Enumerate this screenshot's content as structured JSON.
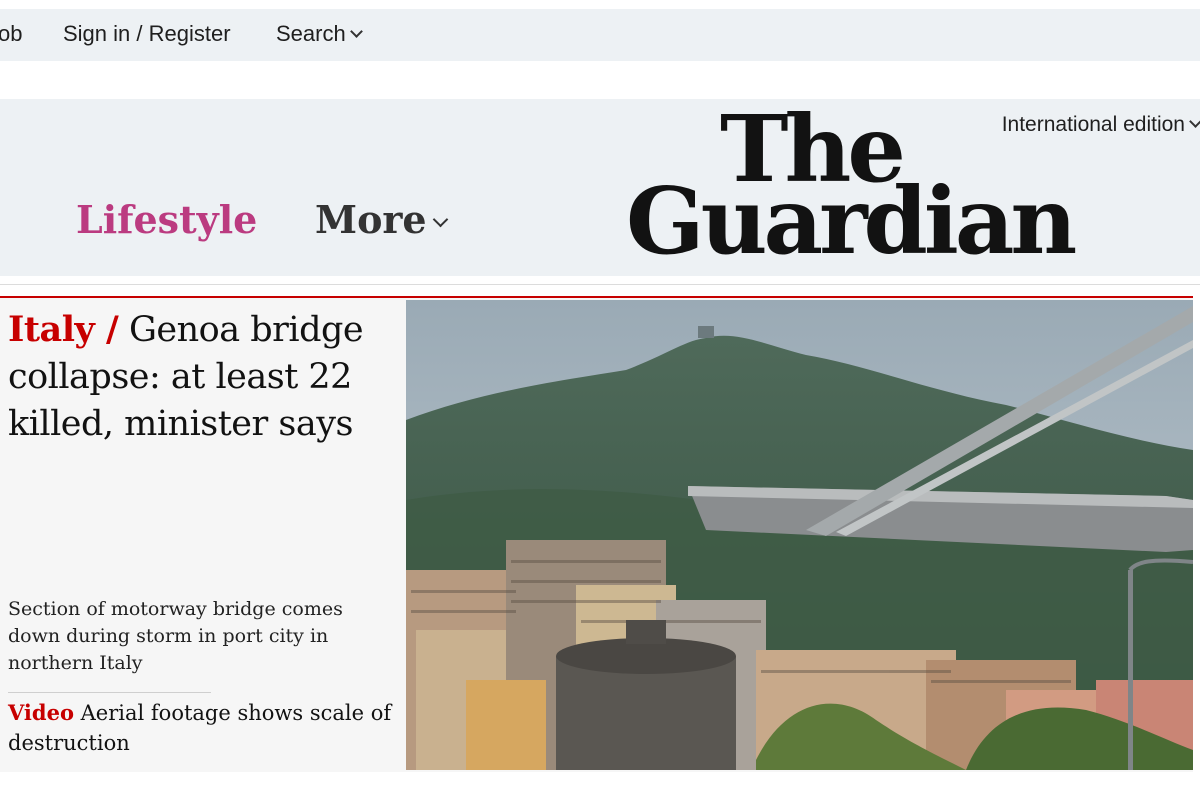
{
  "topbar": {
    "job_link": "ob",
    "signin": "Sign in / Register",
    "search": "Search"
  },
  "header": {
    "edition": "International edition",
    "pillars": {
      "lifestyle": "Lifestyle",
      "more": "More"
    },
    "logo": {
      "line1": "The",
      "line2": "Guardian"
    }
  },
  "story": {
    "kicker": "Italy /",
    "headline": "Genoa bridge collapse: at least 22 killed, minister says",
    "standfirst": "Section of motorway bridge comes down during storm in port city in northern Italy",
    "sublink_kicker": "Video",
    "sublink_text": "Aerial footage shows scale of destruction"
  },
  "colors": {
    "lifestyle": "#bb3b80",
    "news_red": "#c70000",
    "header_bg": "#edf1f4"
  }
}
